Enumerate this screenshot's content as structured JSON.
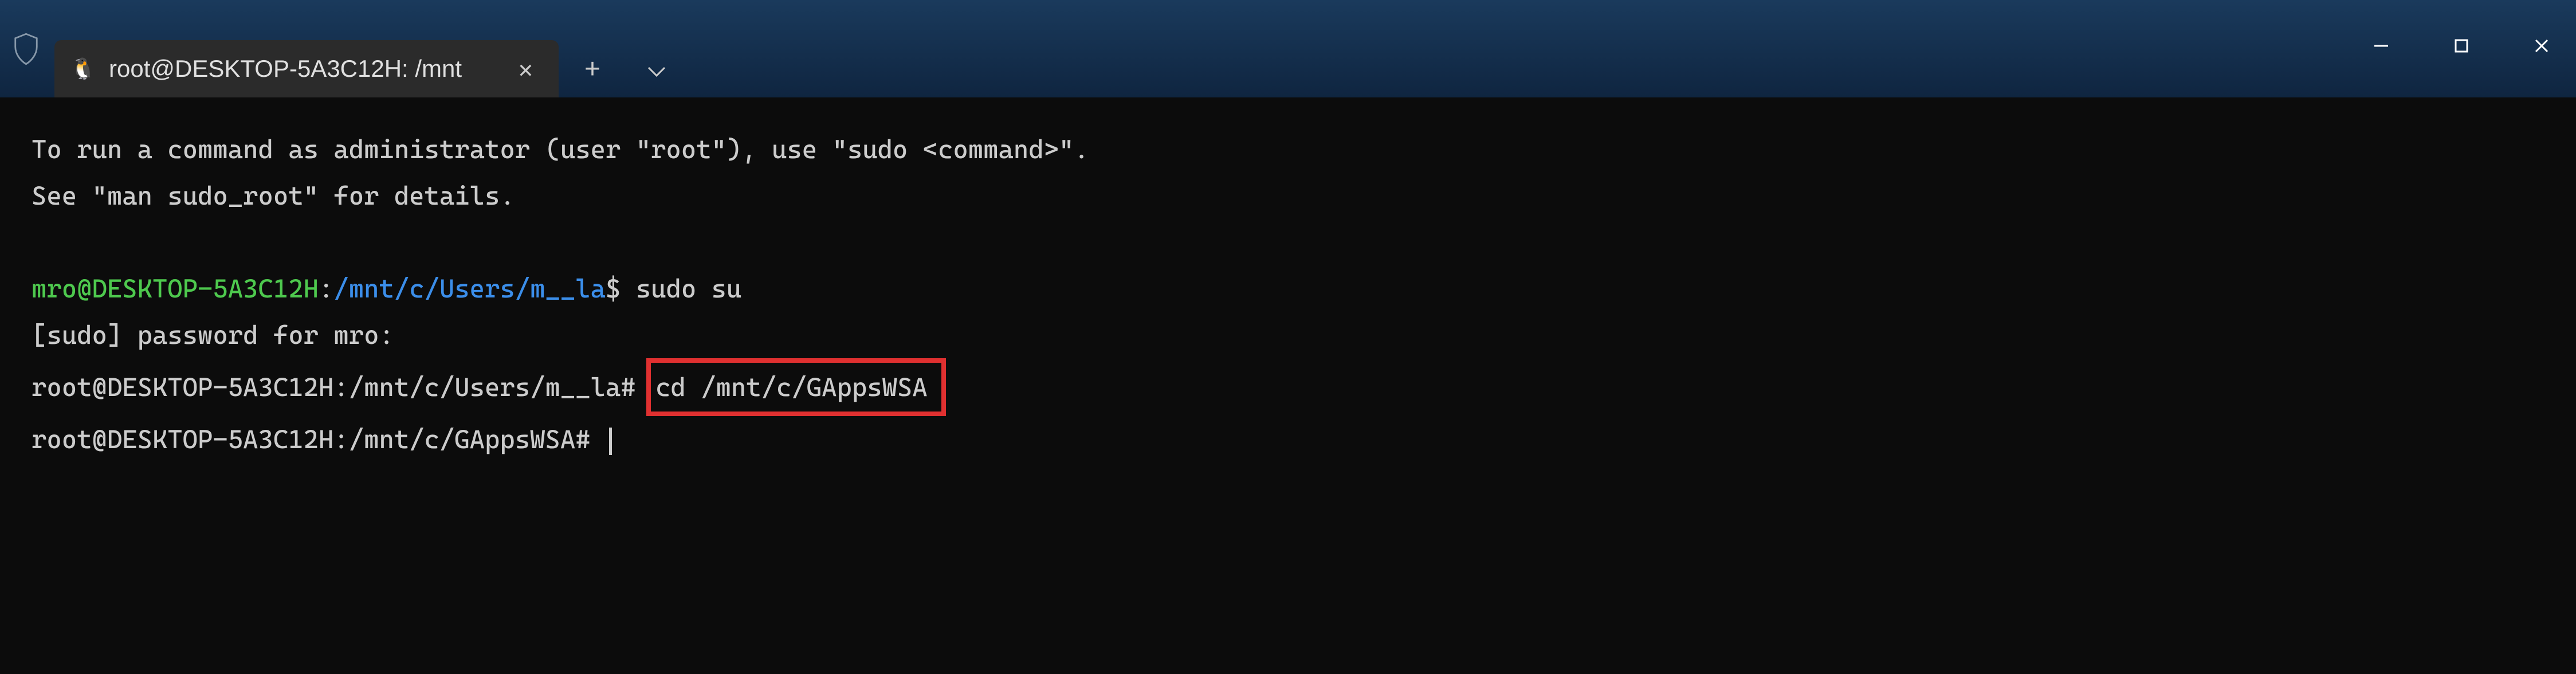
{
  "titlebar": {
    "tab_title": "root@DESKTOP-5A3C12H: /mnt",
    "tab_icon": "🐧"
  },
  "terminal": {
    "line1": "To run a command as administrator (user \"root\"), use \"sudo <command>\".",
    "line2": "See \"man sudo_root\" for details.",
    "prompt1": {
      "user_host": "mro@DESKTOP-5A3C12H",
      "colon": ":",
      "path": "/mnt/c/Users/m__la",
      "dollar": "$",
      "command": " sudo su"
    },
    "line4": "[sudo] password for mro:",
    "prompt2": {
      "full": "root@DESKTOP-5A3C12H:/mnt/c/Users/m__la# ",
      "command": "cd /mnt/c/GAppsWSA"
    },
    "prompt3": {
      "full": "root@DESKTOP-5A3C12H:/mnt/c/GAppsWSA# "
    }
  }
}
